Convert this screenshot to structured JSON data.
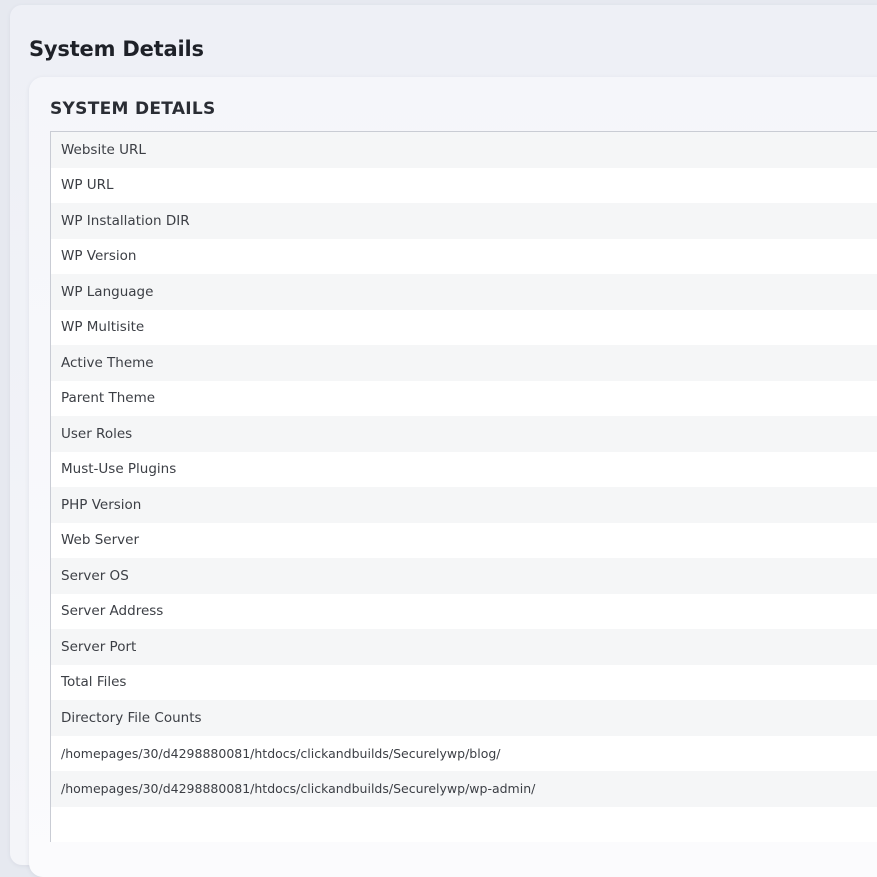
{
  "page": {
    "title": "System Details"
  },
  "card": {
    "title": "SYSTEM DETAILS",
    "rows": [
      "Website URL",
      "WP URL",
      "WP Installation DIR",
      "WP Version",
      "WP Language",
      "WP Multisite",
      "Active Theme",
      "Parent Theme",
      "User Roles",
      "Must-Use Plugins",
      "PHP Version",
      "Web Server",
      "Server OS",
      "Server Address",
      "Server Port",
      "Total Files",
      "Directory File Counts",
      "/homepages/30/d4298880081/htdocs/clickandbuilds/Securelywp/blog/",
      "/homepages/30/d4298880081/htdocs/clickandbuilds/Securelywp/wp-admin/",
      ""
    ]
  }
}
